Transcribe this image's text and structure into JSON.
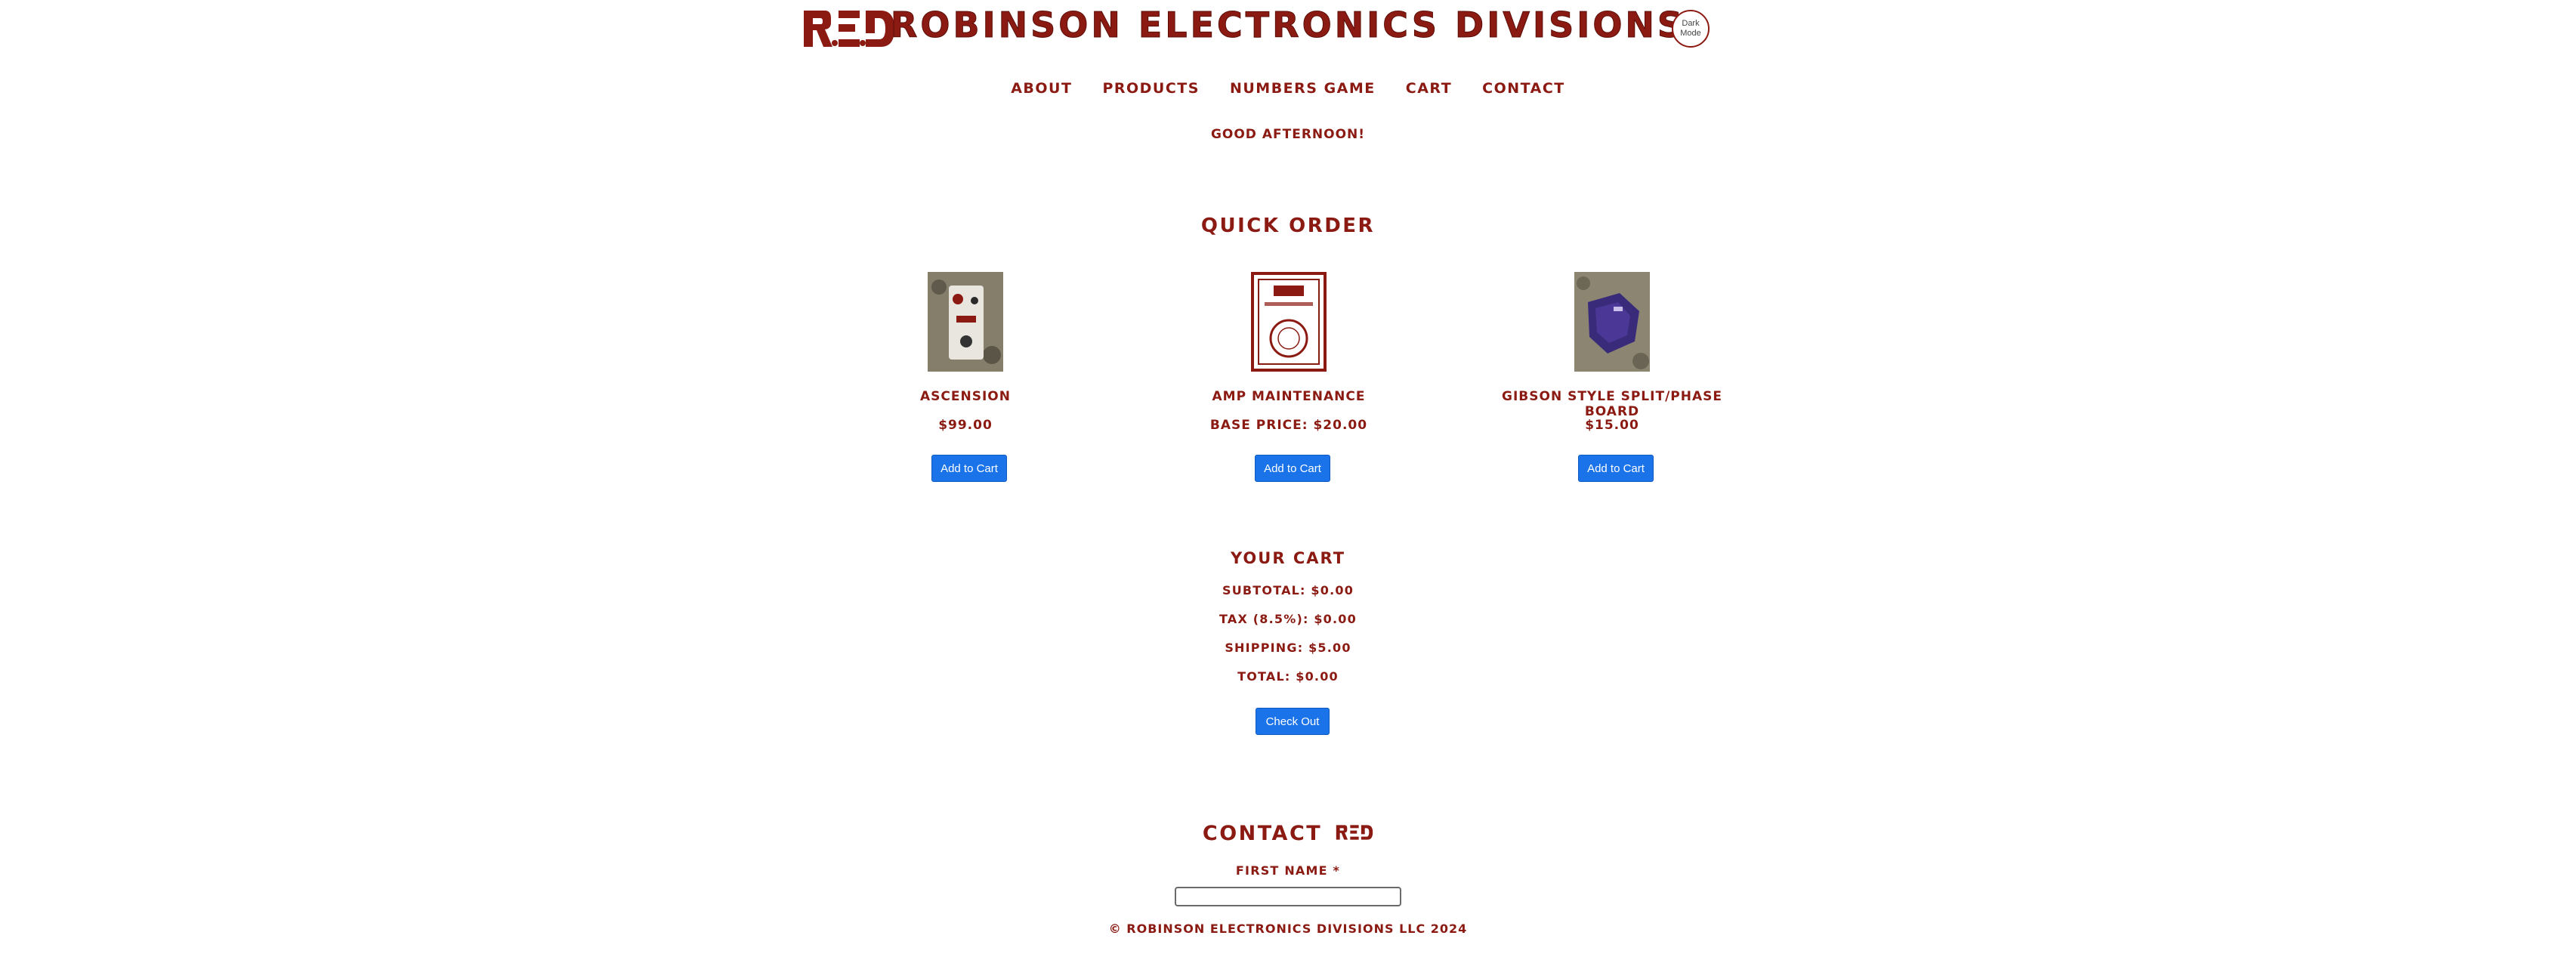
{
  "brand": {
    "logo_text": "R.E.D.",
    "site_title": "ROBINSON ELECTRONICS DIVISIONS",
    "color": "#8b1a12"
  },
  "header": {
    "dark_mode_label": "Dark Mode"
  },
  "nav": {
    "items": [
      {
        "label": "ABOUT"
      },
      {
        "label": "PRODUCTS"
      },
      {
        "label": "NUMBERS GAME"
      },
      {
        "label": "CART"
      },
      {
        "label": "CONTACT"
      }
    ]
  },
  "greeting": "GOOD AFTERNOON!",
  "quick_order": {
    "title": "QUICK ORDER",
    "products": [
      {
        "name": "ASCENSION",
        "price": "$99.00",
        "button": "Add to Cart",
        "thumb_icon": "pedal-photo"
      },
      {
        "name": "AMP MAINTENANCE",
        "price": "BASE PRICE: $20.00",
        "button": "Add to Cart",
        "thumb_icon": "red-service-logo"
      },
      {
        "name": "GIBSON STYLE SPLIT/PHASE BOARD",
        "price": "$15.00",
        "button": "Add to Cart",
        "thumb_icon": "purple-board-photo"
      }
    ]
  },
  "cart": {
    "title": "YOUR CART",
    "subtotal": "SUBTOTAL: $0.00",
    "tax": "TAX (8.5%): $0.00",
    "shipping": "SHIPPING: $5.00",
    "total": "TOTAL: $0.00",
    "checkout_label": "Check Out"
  },
  "contact": {
    "title": "CONTACT",
    "title_logo": "R.E.D.",
    "first_name_label": "FIRST NAME *",
    "first_name_value": ""
  },
  "footer": {
    "copyright": "© ROBINSON ELECTRONICS DIVISIONS LLC 2024"
  },
  "colors": {
    "accent": "#8b1a12",
    "button_blue": "#1a73e8"
  }
}
